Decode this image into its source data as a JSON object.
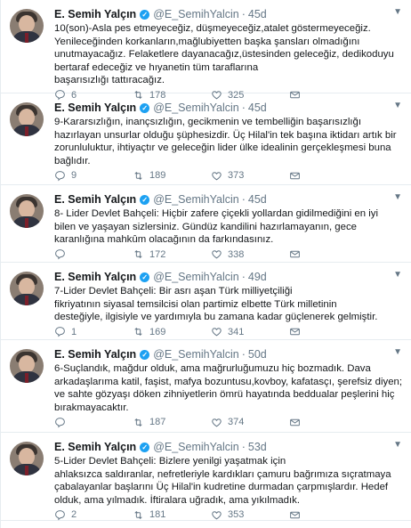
{
  "tweets": [
    {
      "name": "E. Semih Yalçın",
      "handle": "@E_SemihYalcin",
      "time": "45d",
      "lines": [
        "10(son)-Asla pes etmeyeceğiz, düşmeyeceğiz,atalet göstermeyeceğiz.",
        "Yenileceğinden korkanların,mağlubiyetten başka şansları olmadığını",
        "unutmayacağız. Felaketlere dayanacağız,üstesinden geleceğiz, dedikoduyu",
        "bertaraf edeceğiz ve hıyanetin tüm taraflarına",
        "başarısızlığı tattıracağız."
      ],
      "replies": "6",
      "retweets": "178",
      "likes": "325"
    },
    {
      "name": "E. Semih Yalçın",
      "handle": "@E_SemihYalcin",
      "time": "45d",
      "lines": [
        "9-Kararsızlığın, inançsızlığın, gecikmenin ve tembelliğin başarısızlığı",
        "hazırlayan unsurlar olduğu şüphesizdir. Üç Hilal'in tek başına iktidarı artık bir",
        "zorunluluktur, ihtiyaçtır ve geleceğin lider ülke idealinin gerçekleşmesi buna",
        "bağlıdır."
      ],
      "replies": "9",
      "retweets": "189",
      "likes": "373"
    },
    {
      "name": "E. Semih Yalçın",
      "handle": "@E_SemihYalcin",
      "time": "45d",
      "lines": [
        "8- Lider Devlet Bahçeli: Hiçbir zafere çiçekli yollardan gidilmediğini en iyi",
        "bilen ve yaşayan sizlersiniz. Gündüz kandilini hazırlamayanın, gece",
        "karanlığına mahkûm olacağının da farkındasınız."
      ],
      "replies": "",
      "retweets": "172",
      "likes": "338"
    },
    {
      "name": "E. Semih Yalçın",
      "handle": "@E_SemihYalcin",
      "time": "49d",
      "lines": [
        "7-Lider Devlet Bahçeli: Bir asrı aşan Türk milliyetçiliği",
        "fikriyatının siyasal temsilcisi olan partimiz elbette Türk milletinin",
        "desteğiyle, ilgisiyle ve yardımıyla bu zamana kadar güçlenerek gelmiştir."
      ],
      "replies": "1",
      "retweets": "169",
      "likes": "341"
    },
    {
      "name": "E. Semih Yalçın",
      "handle": "@E_SemihYalcin",
      "time": "50d",
      "lines": [
        "6-Suçlandık, mağdur olduk, ama mağrurluğumuzu hiç bozmadık. Dava",
        "arkadaşlarıma katil, faşist, mafya bozuntusu,kovboy, kafatasçı, şerefsiz diyen;",
        "ve sahte gözyaşı döken zihniyetlerin ömrü hayatında beddualar peşlerini hiç",
        "bırakmayacaktır."
      ],
      "replies": "",
      "retweets": "187",
      "likes": "374"
    },
    {
      "name": "E. Semih Yalçın",
      "handle": "@E_SemihYalcin",
      "time": "53d",
      "lines": [
        "5-Lider Devlet Bahçeli: Bizlere yenilgi yaşatmak için",
        "ahlaksızca saldıranlar, nefretleriyle kardıkları çamuru bağrımıza sıçratmaya",
        "çabalayanlar başlarını Üç Hilal'in kudretine durmadan çarpmışlardır. Hedef",
        "olduk, ama yılmadık. İftiralara uğradık, ama yıkılmadık."
      ],
      "replies": "2",
      "retweets": "181",
      "likes": "353"
    }
  ],
  "icons": {
    "reply": "reply-icon",
    "retweet": "retweet-icon",
    "like": "like-icon",
    "dm": "mail-icon",
    "caret": "chevron-down-icon",
    "verified": "verified-badge-icon"
  },
  "colors": {
    "icon_gray": "#657786",
    "verified_blue": "#1da1f2",
    "divider": "#e6ecf0"
  }
}
